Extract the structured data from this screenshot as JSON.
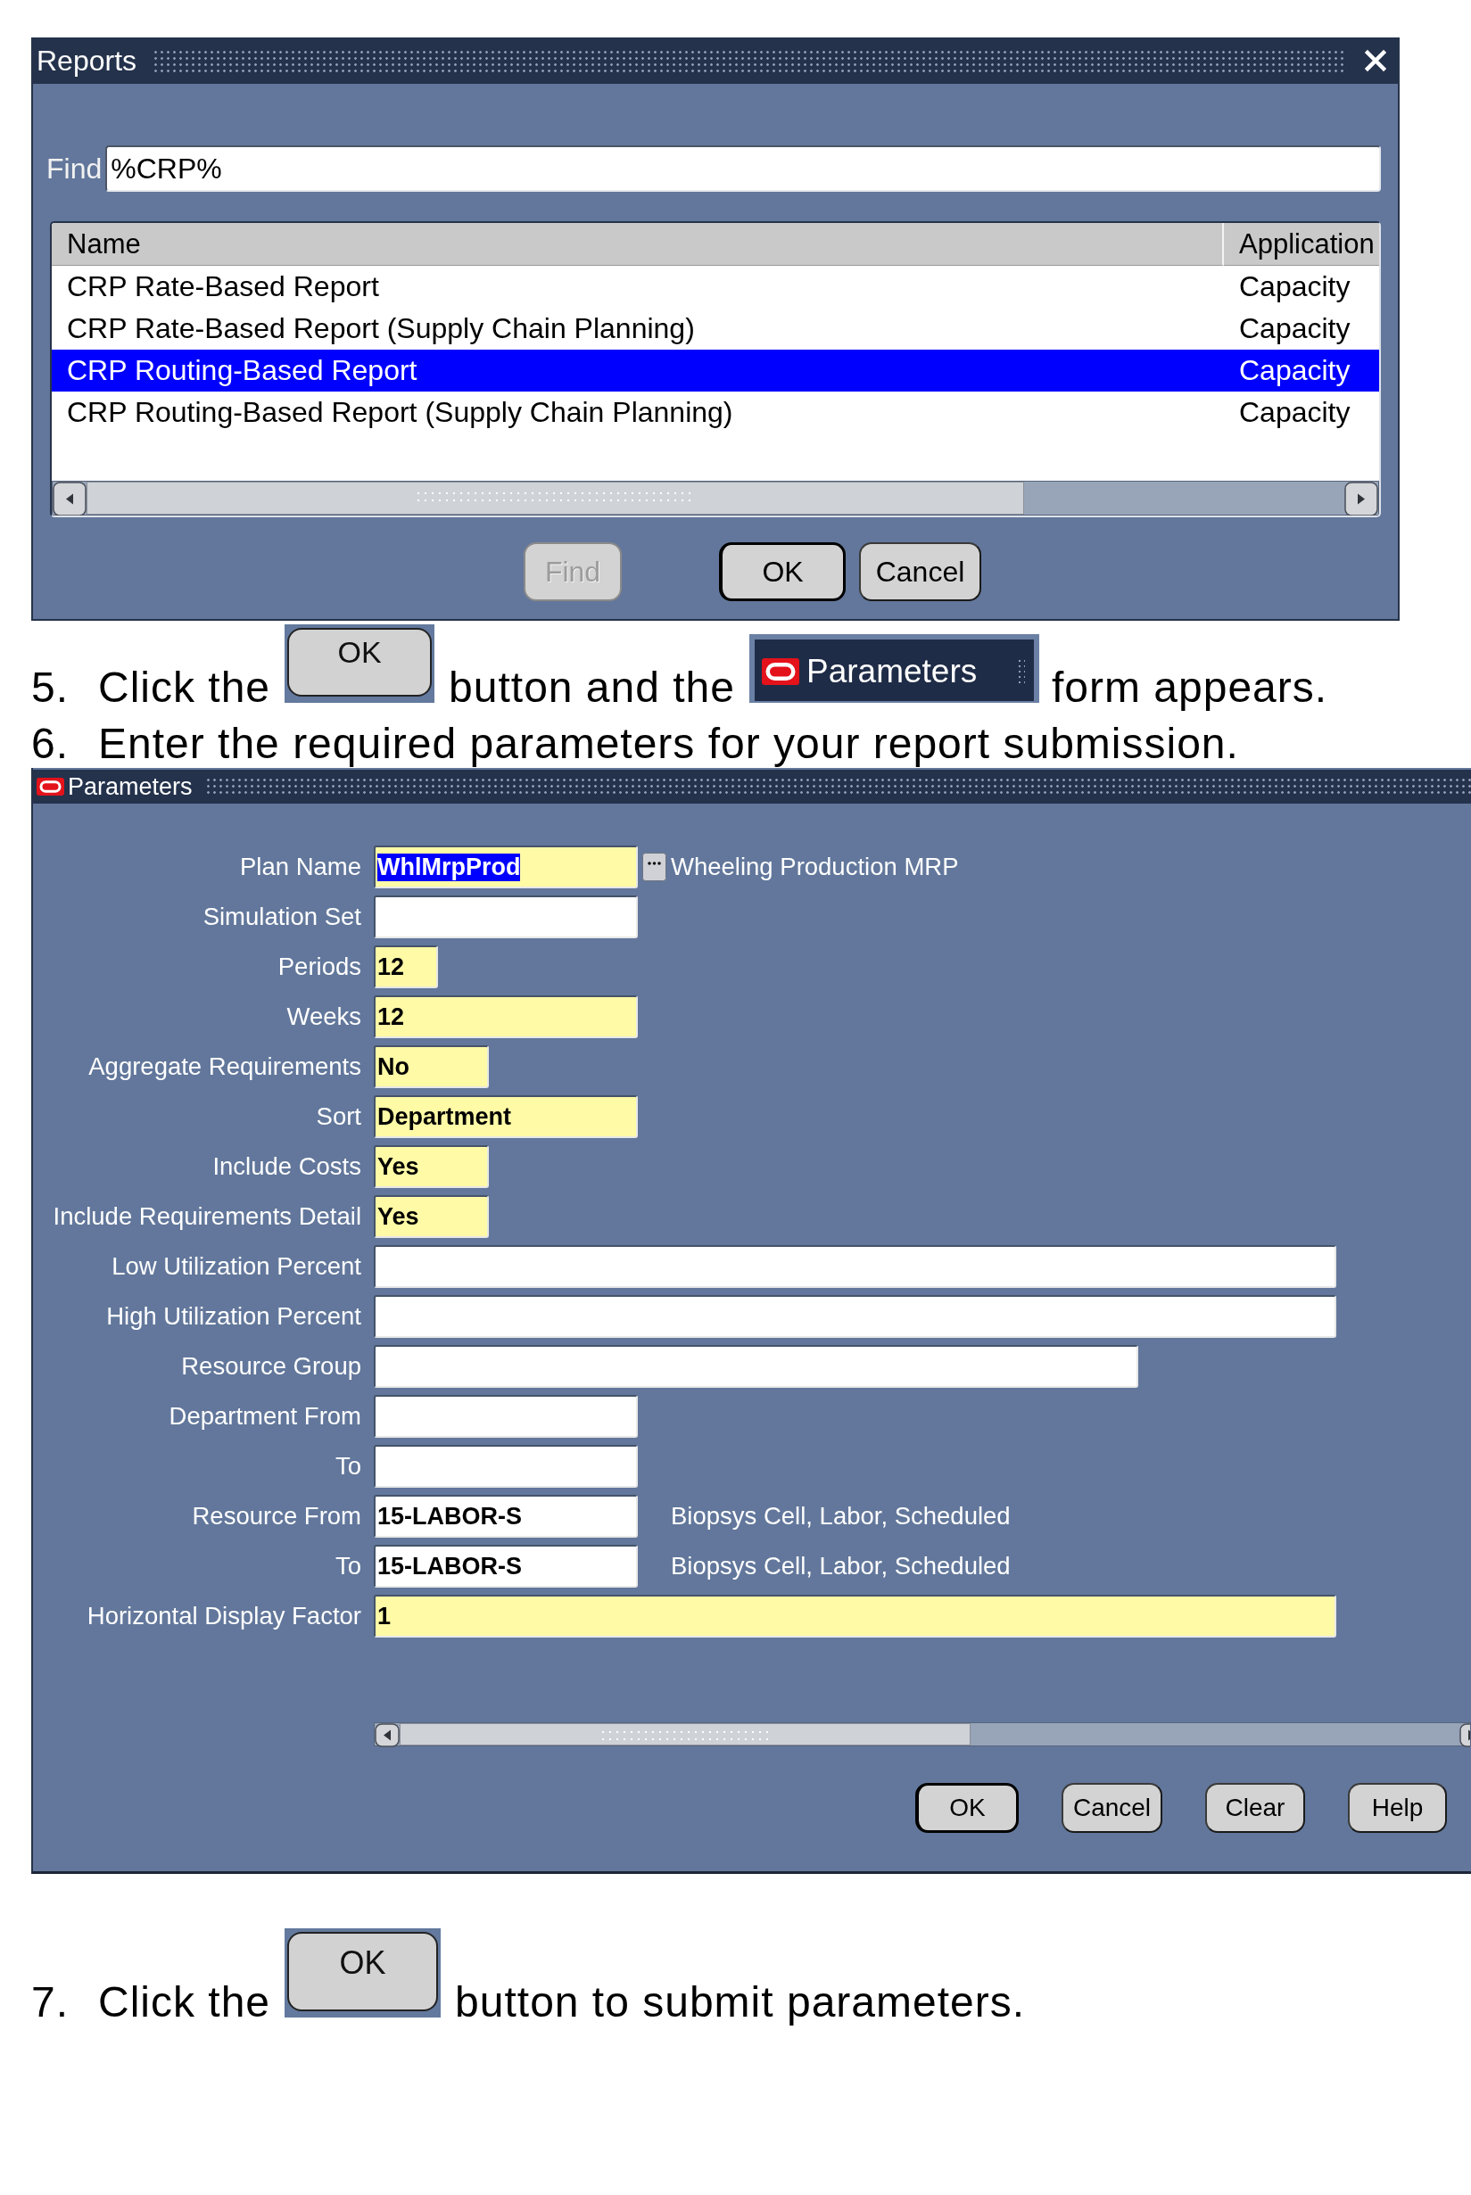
{
  "reports_window": {
    "title": "Reports",
    "find": {
      "label": "Find",
      "value": "%CRP%"
    },
    "columns": [
      "Name",
      "Application"
    ],
    "rows": [
      {
        "name": "CRP Rate-Based Report",
        "application": "Capacity",
        "selected": false
      },
      {
        "name": "CRP Rate-Based Report (Supply Chain Planning)",
        "application": "Capacity",
        "selected": false
      },
      {
        "name": "CRP Routing-Based Report",
        "application": "Capacity",
        "selected": true
      },
      {
        "name": "CRP Routing-Based Report (Supply Chain Planning)",
        "application": "Capacity",
        "selected": false
      }
    ],
    "buttons": [
      {
        "label": "Find",
        "disabled": true,
        "focused": false
      },
      {
        "label": "OK",
        "disabled": false,
        "focused": true
      },
      {
        "label": "Cancel",
        "disabled": false,
        "focused": false
      }
    ]
  },
  "instructions_before": [
    {
      "number": "5.",
      "parts": [
        {
          "kind": "text",
          "text": "Click the"
        },
        {
          "kind": "button",
          "label": "OK"
        },
        {
          "kind": "text",
          "text": "button and the"
        },
        {
          "kind": "titlebar",
          "label": "Parameters"
        },
        {
          "kind": "text",
          "text": "form appears."
        }
      ]
    },
    {
      "number": "6.",
      "parts": [
        {
          "kind": "text",
          "text": "Enter the required parameters for your report submission."
        }
      ]
    }
  ],
  "parameters_window": {
    "title": "Parameters",
    "fields": [
      {
        "label": "Plan Name",
        "kind": "lov",
        "value": "WhlMrpProd",
        "required": true,
        "highlighted": true,
        "description": "Wheeling Production MRP"
      },
      {
        "label": "Simulation Set",
        "kind": "text",
        "required": false
      },
      {
        "label": "Periods",
        "kind": "text",
        "value": "12",
        "required": true,
        "highlighted": false
      },
      {
        "label": "Weeks",
        "kind": "text",
        "value": "12",
        "required": true,
        "highlighted": false
      },
      {
        "label": "Aggregate Requirements",
        "kind": "text",
        "value": "No",
        "required": true,
        "highlighted": false
      },
      {
        "label": "Sort",
        "kind": "text",
        "value": "Department",
        "required": true,
        "highlighted": false
      },
      {
        "label": "Include Costs",
        "kind": "text",
        "value": "Yes",
        "required": true,
        "highlighted": false
      },
      {
        "label": "Include Requirements Detail",
        "kind": "text",
        "value": "Yes",
        "required": true,
        "highlighted": false
      },
      {
        "label": "Low Utilization Percent",
        "kind": "text",
        "required": false
      },
      {
        "label": "High Utilization Percent",
        "kind": "text",
        "required": false
      },
      {
        "label": "Resource Group",
        "kind": "text",
        "required": false
      },
      {
        "label": "Department From",
        "kind": "text",
        "required": false
      },
      {
        "label": "To",
        "kind": "text",
        "required": false
      },
      {
        "label": "Resource From",
        "kind": "text",
        "value": "15-LABOR-S",
        "required": false,
        "highlighted": false,
        "description": "Biopsys Cell, Labor, Scheduled"
      },
      {
        "label": "To",
        "kind": "text",
        "value": "15-LABOR-S",
        "required": false,
        "highlighted": false,
        "description": "Biopsys Cell, Labor, Scheduled"
      },
      {
        "label": "Horizontal Display Factor",
        "kind": "text",
        "value": "1",
        "required": true,
        "highlighted": false
      }
    ],
    "buttons": [
      {
        "label": "OK",
        "focused": true
      },
      {
        "label": "Cancel",
        "focused": false
      },
      {
        "label": "Clear",
        "focused": false
      },
      {
        "label": "Help",
        "focused": false
      }
    ]
  },
  "instructions_after": [
    {
      "number": "7.",
      "parts": [
        {
          "kind": "text",
          "text": "Click the"
        },
        {
          "kind": "button",
          "label": "OK"
        },
        {
          "kind": "text",
          "text": "button to submit parameters."
        }
      ]
    }
  ]
}
